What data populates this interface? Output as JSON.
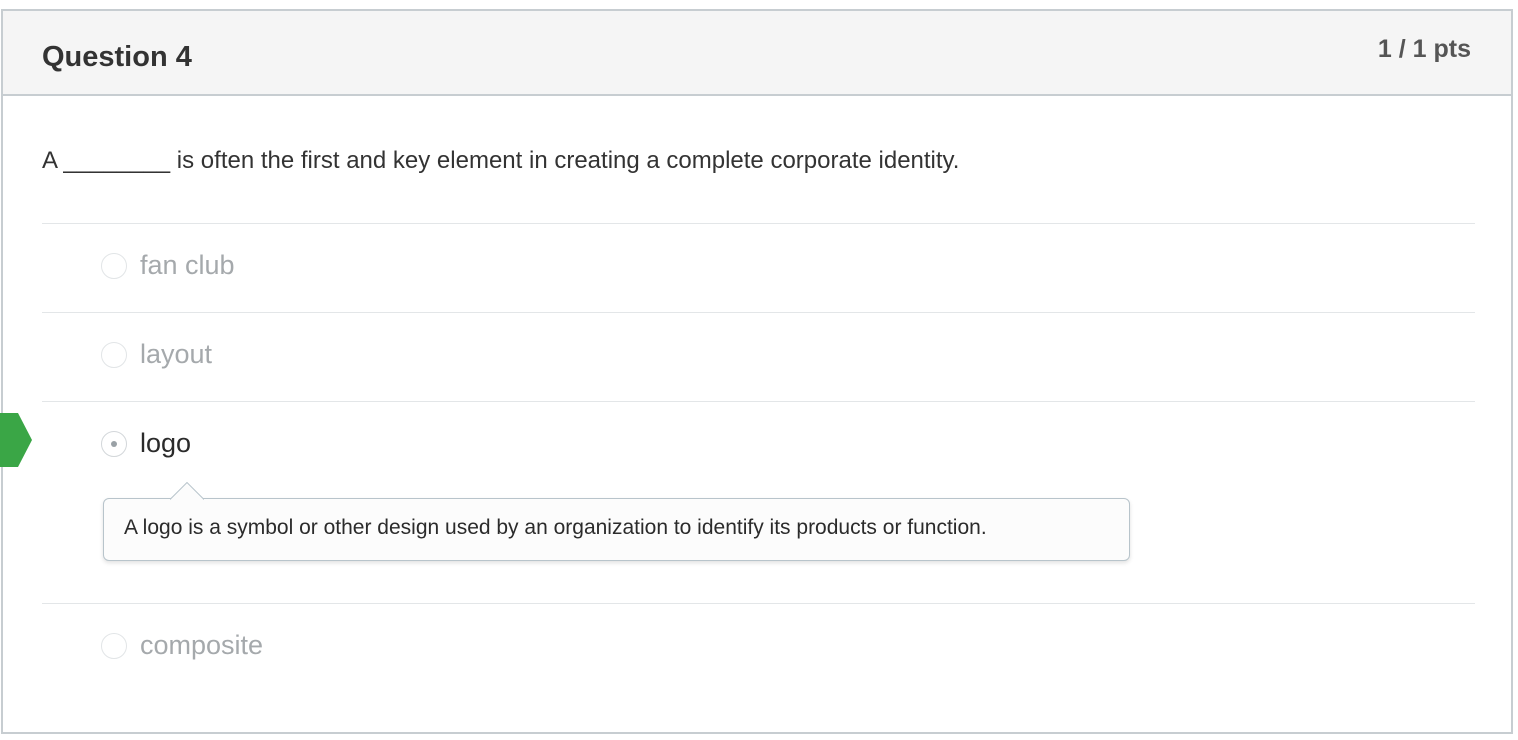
{
  "question": {
    "title": "Question 4",
    "points": "1 / 1 pts",
    "text": "A ________ is often the first and key element in creating a complete corporate identity."
  },
  "answers": [
    {
      "label": "fan club",
      "selected": false
    },
    {
      "label": "layout",
      "selected": false
    },
    {
      "label": "logo",
      "selected": true
    },
    {
      "label": "composite",
      "selected": false
    }
  ],
  "feedback": {
    "text": "A logo is a symbol or other design used by an organization to identify its products or function."
  },
  "icons": {
    "correct_marker": "correct-answer-arrow-icon",
    "radio": "radio-icon"
  },
  "colors": {
    "correct_marker": "#3aa646",
    "header_bg": "#f5f5f5",
    "border": "#c7cdd1",
    "unselected_text": "#a5a9ac"
  }
}
